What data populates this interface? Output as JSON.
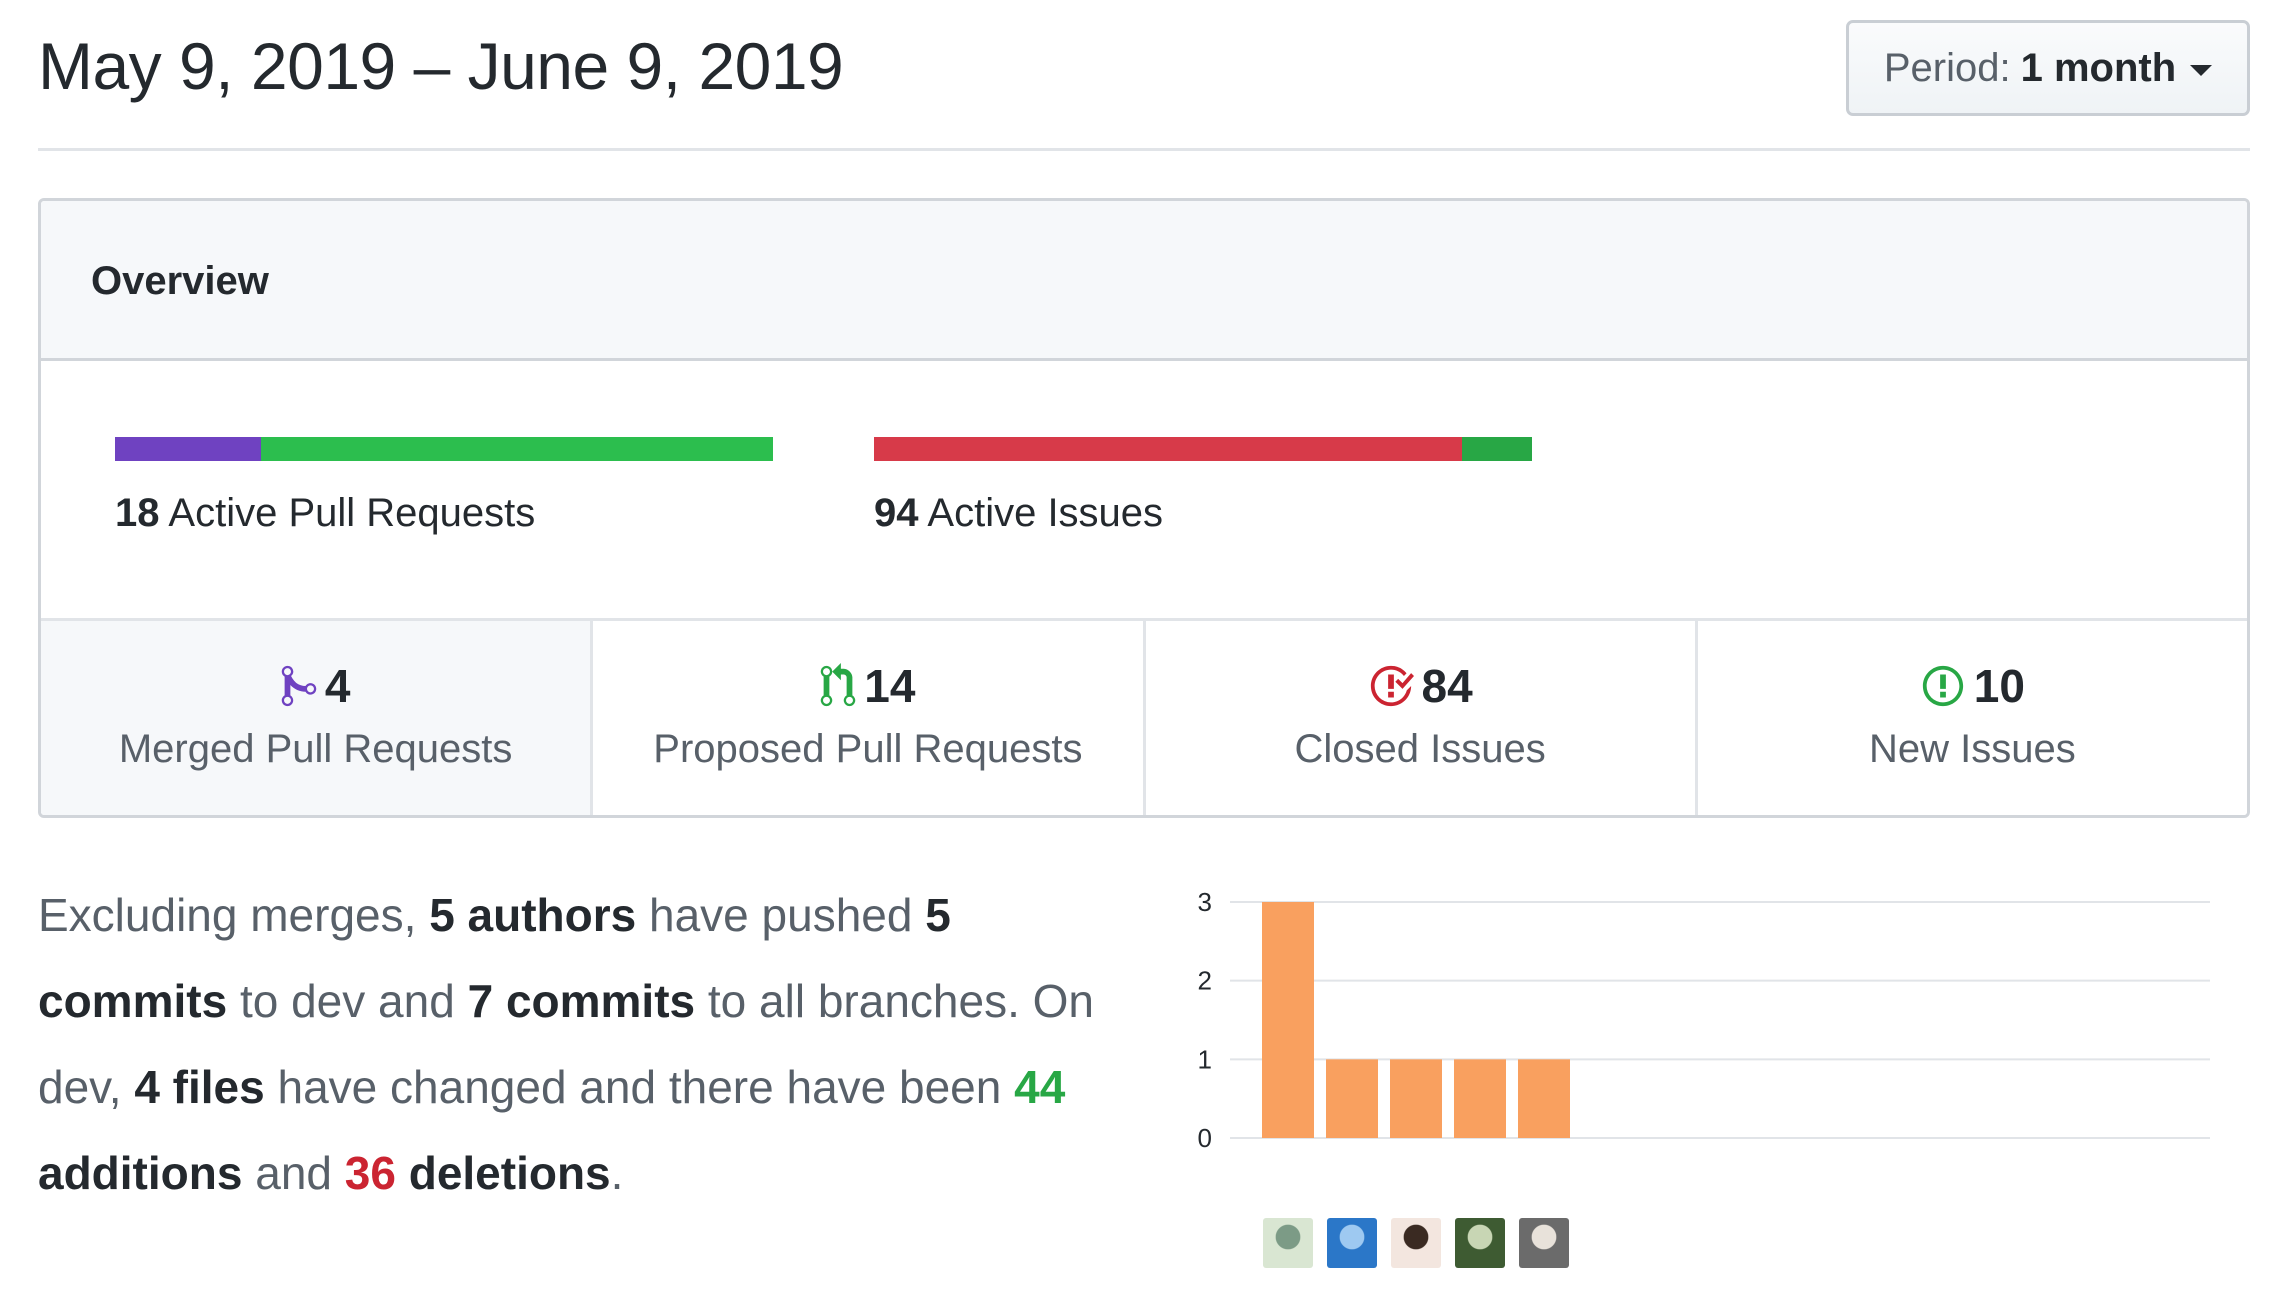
{
  "header": {
    "date_range": "May 9, 2019 – June 9, 2019",
    "period_label": "Period:",
    "period_value": "1 month"
  },
  "overview": {
    "title": "Overview",
    "pull_requests": {
      "count": "18",
      "label": "Active Pull Requests",
      "merged_fraction": 0.222,
      "open_fraction": 0.778
    },
    "issues": {
      "count": "94",
      "label": "Active Issues",
      "closed_fraction": 0.894,
      "new_fraction": 0.106
    },
    "stats": [
      {
        "count": "4",
        "label": "Merged Pull Requests",
        "icon": "git-merge-icon"
      },
      {
        "count": "14",
        "label": "Proposed Pull Requests",
        "icon": "git-pull-request-icon"
      },
      {
        "count": "84",
        "label": "Closed Issues",
        "icon": "issue-closed-icon"
      },
      {
        "count": "10",
        "label": "New Issues",
        "icon": "issue-opened-icon"
      }
    ]
  },
  "summary": {
    "t1": "Excluding merges, ",
    "authors": "5 authors",
    "t2": " have pushed ",
    "commits_dev": "5 commits",
    "t3": " to dev and ",
    "commits_all": "7 commits",
    "t4": " to all branches. On dev, ",
    "files": "4 files",
    "t5": " have changed and there have been ",
    "additions_num": "44",
    "additions_word": "additions",
    "t6": " and ",
    "deletions_num": "36",
    "deletions_word": "deletions",
    "t7": "."
  },
  "colors": {
    "merged": "#6f42c1",
    "open": "#2cbe4e",
    "closed": "#d73a49",
    "new": "#28a745",
    "bar": "#f9a05f"
  },
  "chart_data": {
    "type": "bar",
    "categories": [
      "author-1",
      "author-2",
      "author-3",
      "author-4",
      "author-5"
    ],
    "values": [
      3,
      1,
      1,
      1,
      1
    ],
    "ylim": [
      0,
      3
    ],
    "yticks": [
      "0",
      "1",
      "2",
      "3"
    ],
    "grid": true,
    "x_tick_style": "author avatars"
  }
}
